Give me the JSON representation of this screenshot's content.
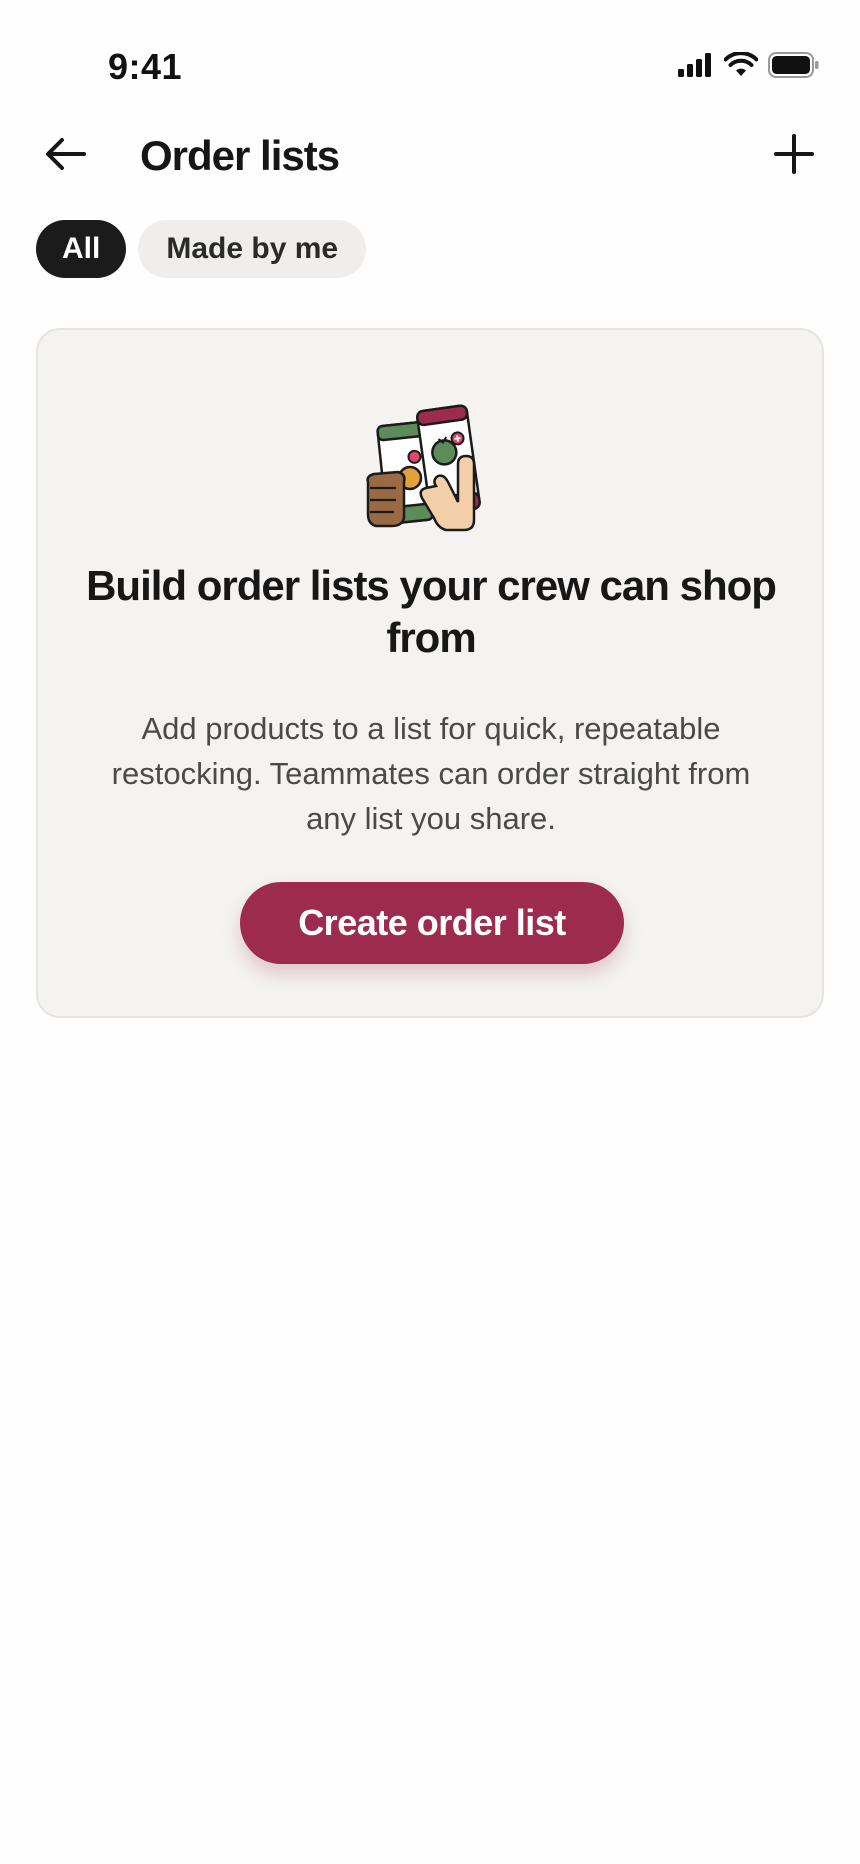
{
  "status_bar": {
    "time": "9:41",
    "icons": [
      "signal-icon",
      "wifi-icon",
      "battery-icon"
    ]
  },
  "header": {
    "back_icon": "arrow-left-icon",
    "title": "Order lists",
    "add_icon": "plus-icon"
  },
  "filters": {
    "chips": [
      {
        "label": "All",
        "selected": true
      },
      {
        "label": "Made by me",
        "selected": false
      }
    ]
  },
  "empty_state": {
    "illustration": "phones-in-hands-illustration",
    "heading": "Build order lists your crew can shop from",
    "body": "Add products to a list for quick, repeatable restocking. Teammates can order straight from any list you share.",
    "button_label": "Create order list"
  },
  "colors": {
    "accent": "#9c2b4e",
    "chip_active_bg": "#1b1b1b",
    "chip_inactive_bg": "#efeeec",
    "card_bg": "#f4f3f1",
    "card_border": "#e6e4e1",
    "illustration_green": "#5c8c5a",
    "illustration_orange": "#e1a23a",
    "illustration_skin_dark": "#9a6a45",
    "illustration_skin_light": "#f2cfa8"
  }
}
